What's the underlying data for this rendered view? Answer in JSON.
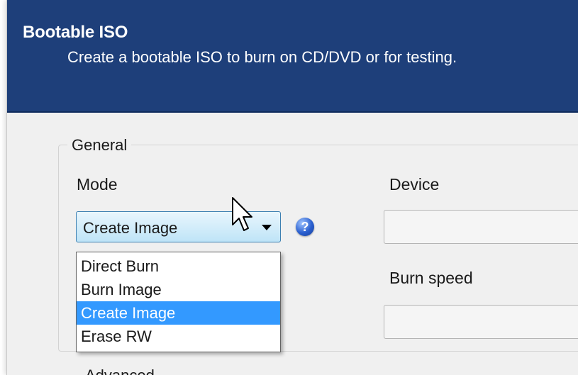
{
  "header": {
    "title": "Bootable ISO",
    "subtitle": "Create a bootable ISO to burn on CD/DVD or for testing."
  },
  "group": {
    "legend": "General"
  },
  "mode": {
    "label": "Mode",
    "selected": "Create Image",
    "options": [
      "Direct Burn",
      "Burn Image",
      "Create Image",
      "Erase RW"
    ],
    "highlighted_index": 2
  },
  "device": {
    "label": "Device",
    "value": ""
  },
  "burn_speed": {
    "label": "Burn speed",
    "value": ""
  },
  "next_section": {
    "label": "Advanced"
  },
  "icons": {
    "help": "help-icon",
    "cursor": "mouse-cursor-icon"
  },
  "colors": {
    "header": "#1e3f7a",
    "selection": "#3399ff"
  }
}
